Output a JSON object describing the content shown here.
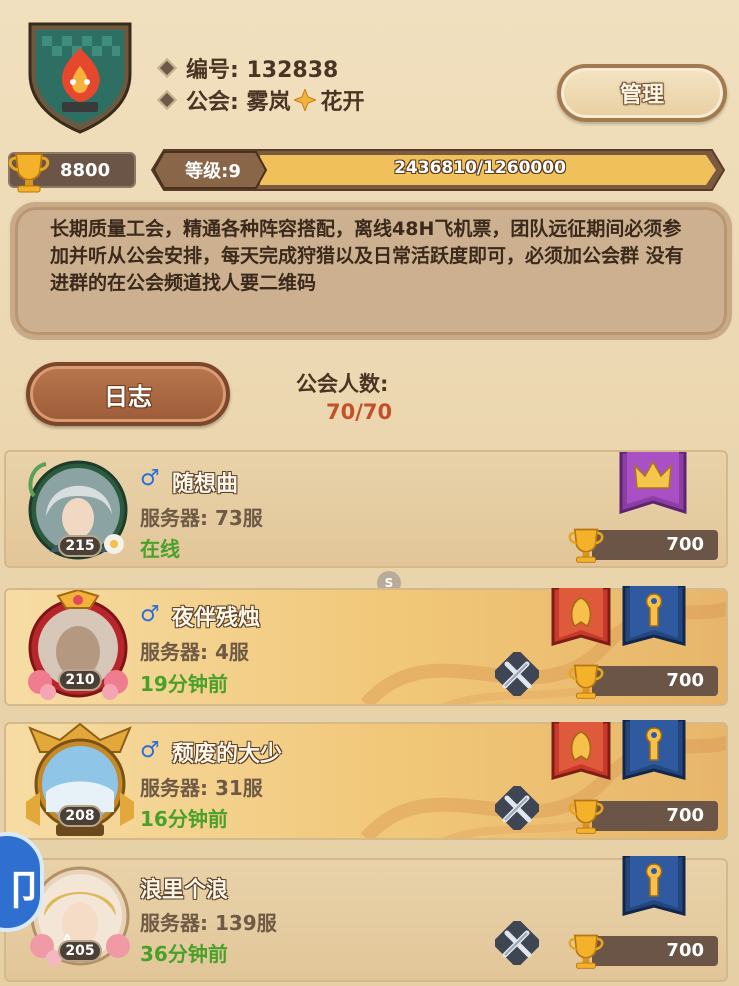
{
  "guild": {
    "id_label": "编号: 132838",
    "name_prefix": "公会: 雾岚",
    "name_suffix": "花开",
    "manage_label": "管理",
    "trophy": "8800",
    "level_label": "等级:9",
    "exp": "2436810/1260000",
    "exp_progress": 1.0,
    "notice": "长期质量工会，精通各种阵容搭配，离线48H飞机票，团队远征期间必须参加并听从公会安排，每天完成狩猎以及日常活跃度即可，必须加公会群 没有进群的在公会频道找人要二维码",
    "log_label": "日志",
    "member_count_label": "公会人数:",
    "member_count": "70/70"
  },
  "float_badge": "S",
  "members": [
    {
      "gender": "♂",
      "name": "随想曲",
      "server": "服务器: 73服",
      "status": "在线",
      "level": "215",
      "score": "700"
    },
    {
      "gender": "♂",
      "name": "夜伴残烛",
      "server": "服务器: 4服",
      "status": "19分钟前",
      "level": "210",
      "score": "700"
    },
    {
      "gender": "♂",
      "name": "颓废的大少",
      "server": "服务器: 31服",
      "status": "16分钟前",
      "level": "208",
      "score": "700"
    },
    {
      "gender": "",
      "name": "浪里个浪",
      "server": "服务器: 139服",
      "status": "36分钟前",
      "level": "205",
      "score": "700"
    }
  ],
  "colors": {
    "online": "#49a12a",
    "offline": "#49a12a",
    "male": "#2e6fd8",
    "member_count": "#c2502a"
  }
}
